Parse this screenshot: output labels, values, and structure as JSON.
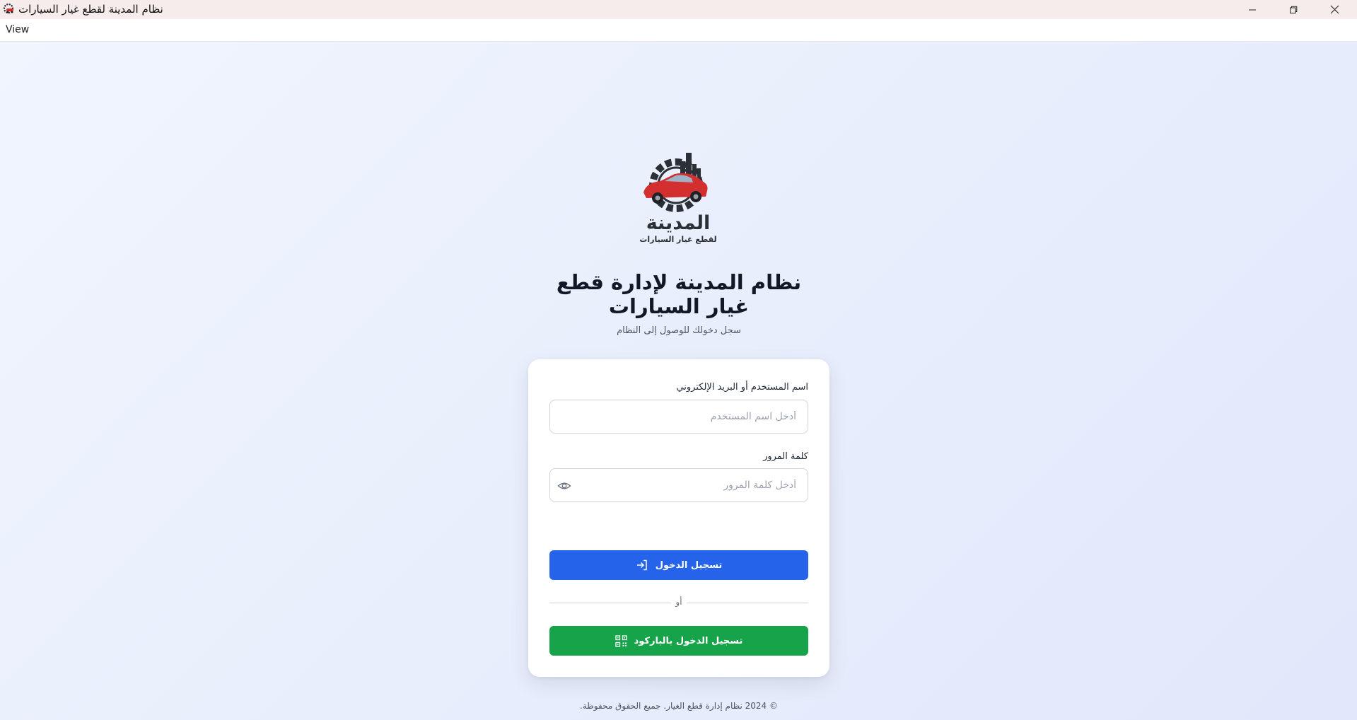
{
  "window": {
    "title": "نظام المدينة لقطع غيار السيارات",
    "app_icon": "car-gear-icon",
    "controls": {
      "minimize": "minimize-icon",
      "maximize": "restore-icon",
      "close": "close-icon"
    }
  },
  "menubar": {
    "items": [
      {
        "label": "View"
      }
    ]
  },
  "brand": {
    "logo_icon": "car-gear-city-logo",
    "logo_text_main": "المدينة",
    "logo_text_sub": "لقطع غيار السيارات"
  },
  "page": {
    "title": "نظام المدينة لإدارة قطع غيار السيارات",
    "subtitle": "سجل دخولك للوصول إلى النظام"
  },
  "form": {
    "username": {
      "label": "اسم المستخدم أو البريد الإلكتروني",
      "value": "",
      "placeholder": "أدخل اسم المستخدم"
    },
    "password": {
      "label": "كلمة المرور",
      "value": "",
      "placeholder": "أدخل كلمة المرور",
      "toggle_icon": "eye-icon"
    },
    "login_button": {
      "label": "تسجيل الدخول",
      "icon": "login-icon"
    },
    "divider_text": "أو",
    "barcode_button": {
      "label": "تسجيل الدخول بالباركود",
      "icon": "qr-code-icon"
    }
  },
  "footer": {
    "text": "© 2024 نظام إدارة قطع الغيار. جميع الحقوق محفوظة."
  },
  "colors": {
    "primary": "#2563eb",
    "success": "#16a34a",
    "background": "#eef2fb",
    "card": "#ffffff",
    "titlebar": "#f6ecec"
  }
}
